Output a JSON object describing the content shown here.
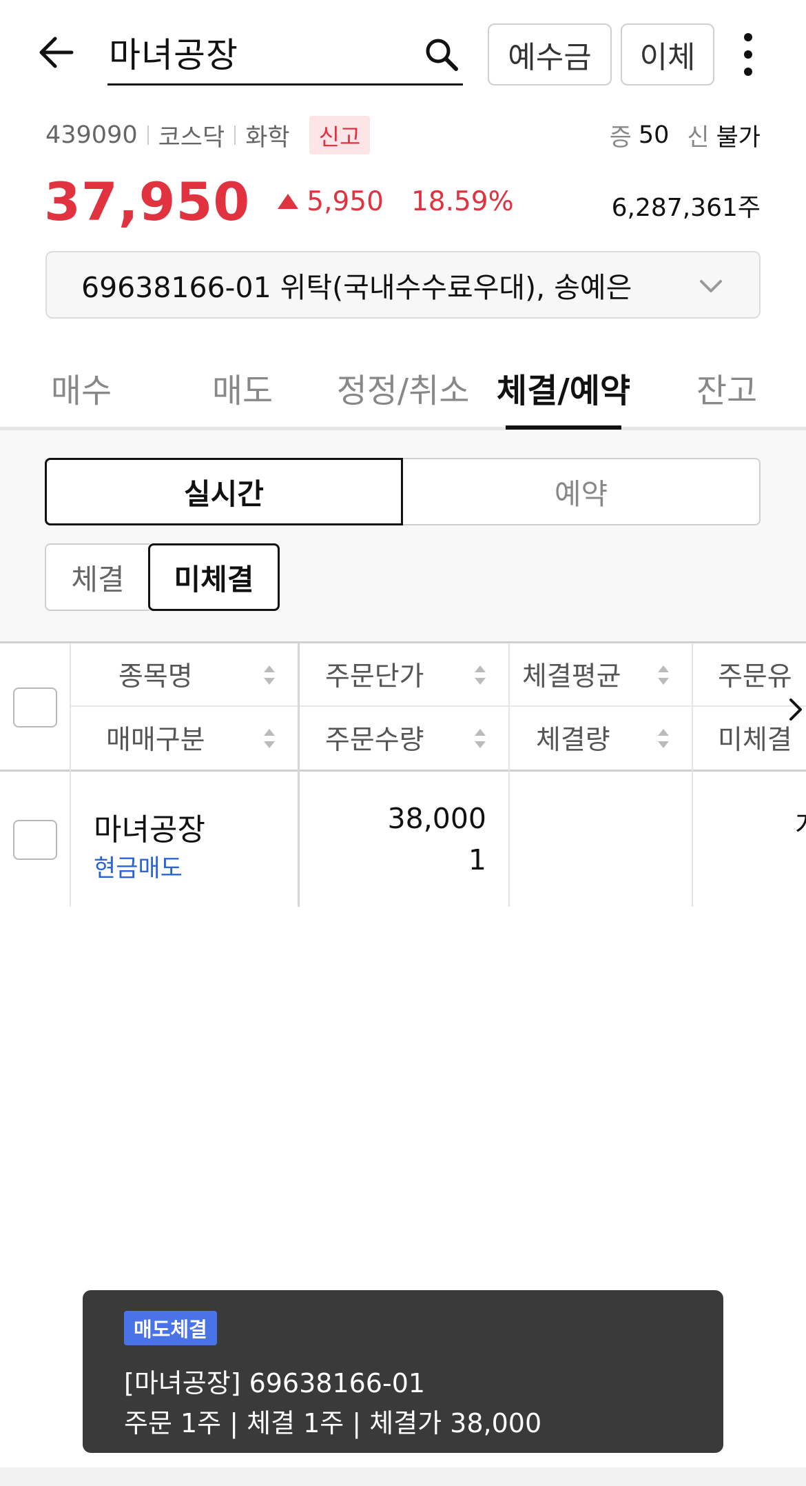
{
  "header": {
    "search_value": "마녀공장",
    "deposit_label": "예수금",
    "transfer_label": "이체"
  },
  "stock": {
    "code": "439090",
    "market": "코스닥",
    "sector": "화학",
    "warning_badge": "신고",
    "margin_label": "증",
    "margin_value": "50",
    "credit_label": "신",
    "credit_value": "불가",
    "price": "37,950",
    "change": "5,950",
    "change_pct": "18.59%",
    "volume": "6,287,361주",
    "price_color": "#e0323f"
  },
  "account": {
    "text": "69638166-01 위탁(국내수수료우대), 송예은"
  },
  "tabs": [
    {
      "label": "매수"
    },
    {
      "label": "매도"
    },
    {
      "label": "정정/취소"
    },
    {
      "label": "체결/예약"
    },
    {
      "label": "잔고"
    }
  ],
  "active_tab": "체결/예약",
  "segments": {
    "realtime": "실시간",
    "reserve": "예약"
  },
  "filters": {
    "done": "체결",
    "pending": "미체결"
  },
  "table": {
    "headers_top": [
      "종목명",
      "주문단가",
      "체결평균",
      "주문유"
    ],
    "headers_bottom": [
      "매매구분",
      "주문수량",
      "체결량",
      "미체결"
    ],
    "rows": [
      {
        "name": "마녀공장",
        "type": "현금매도",
        "order_price": "38,000",
        "order_qty": "1",
        "cut_text": "개"
      }
    ]
  },
  "toast": {
    "badge": "매도체결",
    "line1": "[마녀공장] 69638166-01",
    "line2": "주문 1주 | 체결 1주 | 체결가 38,000",
    "badge_color": "#4a73e8"
  },
  "icons": [
    "back-arrow-icon",
    "search-icon",
    "more-vertical-icon",
    "chevron-down-icon",
    "sort-icon",
    "chevron-right-icon"
  ]
}
